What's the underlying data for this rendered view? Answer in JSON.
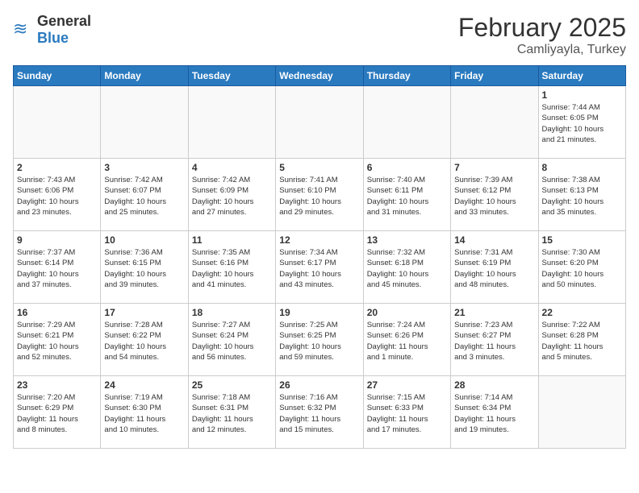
{
  "header": {
    "logo_general": "General",
    "logo_blue": "Blue",
    "month": "February 2025",
    "location": "Camliyayla, Turkey"
  },
  "days_of_week": [
    "Sunday",
    "Monday",
    "Tuesday",
    "Wednesday",
    "Thursday",
    "Friday",
    "Saturday"
  ],
  "weeks": [
    [
      {
        "day": "",
        "info": ""
      },
      {
        "day": "",
        "info": ""
      },
      {
        "day": "",
        "info": ""
      },
      {
        "day": "",
        "info": ""
      },
      {
        "day": "",
        "info": ""
      },
      {
        "day": "",
        "info": ""
      },
      {
        "day": "1",
        "info": "Sunrise: 7:44 AM\nSunset: 6:05 PM\nDaylight: 10 hours\nand 21 minutes."
      }
    ],
    [
      {
        "day": "2",
        "info": "Sunrise: 7:43 AM\nSunset: 6:06 PM\nDaylight: 10 hours\nand 23 minutes."
      },
      {
        "day": "3",
        "info": "Sunrise: 7:42 AM\nSunset: 6:07 PM\nDaylight: 10 hours\nand 25 minutes."
      },
      {
        "day": "4",
        "info": "Sunrise: 7:42 AM\nSunset: 6:09 PM\nDaylight: 10 hours\nand 27 minutes."
      },
      {
        "day": "5",
        "info": "Sunrise: 7:41 AM\nSunset: 6:10 PM\nDaylight: 10 hours\nand 29 minutes."
      },
      {
        "day": "6",
        "info": "Sunrise: 7:40 AM\nSunset: 6:11 PM\nDaylight: 10 hours\nand 31 minutes."
      },
      {
        "day": "7",
        "info": "Sunrise: 7:39 AM\nSunset: 6:12 PM\nDaylight: 10 hours\nand 33 minutes."
      },
      {
        "day": "8",
        "info": "Sunrise: 7:38 AM\nSunset: 6:13 PM\nDaylight: 10 hours\nand 35 minutes."
      }
    ],
    [
      {
        "day": "9",
        "info": "Sunrise: 7:37 AM\nSunset: 6:14 PM\nDaylight: 10 hours\nand 37 minutes."
      },
      {
        "day": "10",
        "info": "Sunrise: 7:36 AM\nSunset: 6:15 PM\nDaylight: 10 hours\nand 39 minutes."
      },
      {
        "day": "11",
        "info": "Sunrise: 7:35 AM\nSunset: 6:16 PM\nDaylight: 10 hours\nand 41 minutes."
      },
      {
        "day": "12",
        "info": "Sunrise: 7:34 AM\nSunset: 6:17 PM\nDaylight: 10 hours\nand 43 minutes."
      },
      {
        "day": "13",
        "info": "Sunrise: 7:32 AM\nSunset: 6:18 PM\nDaylight: 10 hours\nand 45 minutes."
      },
      {
        "day": "14",
        "info": "Sunrise: 7:31 AM\nSunset: 6:19 PM\nDaylight: 10 hours\nand 48 minutes."
      },
      {
        "day": "15",
        "info": "Sunrise: 7:30 AM\nSunset: 6:20 PM\nDaylight: 10 hours\nand 50 minutes."
      }
    ],
    [
      {
        "day": "16",
        "info": "Sunrise: 7:29 AM\nSunset: 6:21 PM\nDaylight: 10 hours\nand 52 minutes."
      },
      {
        "day": "17",
        "info": "Sunrise: 7:28 AM\nSunset: 6:22 PM\nDaylight: 10 hours\nand 54 minutes."
      },
      {
        "day": "18",
        "info": "Sunrise: 7:27 AM\nSunset: 6:24 PM\nDaylight: 10 hours\nand 56 minutes."
      },
      {
        "day": "19",
        "info": "Sunrise: 7:25 AM\nSunset: 6:25 PM\nDaylight: 10 hours\nand 59 minutes."
      },
      {
        "day": "20",
        "info": "Sunrise: 7:24 AM\nSunset: 6:26 PM\nDaylight: 11 hours\nand 1 minute."
      },
      {
        "day": "21",
        "info": "Sunrise: 7:23 AM\nSunset: 6:27 PM\nDaylight: 11 hours\nand 3 minutes."
      },
      {
        "day": "22",
        "info": "Sunrise: 7:22 AM\nSunset: 6:28 PM\nDaylight: 11 hours\nand 5 minutes."
      }
    ],
    [
      {
        "day": "23",
        "info": "Sunrise: 7:20 AM\nSunset: 6:29 PM\nDaylight: 11 hours\nand 8 minutes."
      },
      {
        "day": "24",
        "info": "Sunrise: 7:19 AM\nSunset: 6:30 PM\nDaylight: 11 hours\nand 10 minutes."
      },
      {
        "day": "25",
        "info": "Sunrise: 7:18 AM\nSunset: 6:31 PM\nDaylight: 11 hours\nand 12 minutes."
      },
      {
        "day": "26",
        "info": "Sunrise: 7:16 AM\nSunset: 6:32 PM\nDaylight: 11 hours\nand 15 minutes."
      },
      {
        "day": "27",
        "info": "Sunrise: 7:15 AM\nSunset: 6:33 PM\nDaylight: 11 hours\nand 17 minutes."
      },
      {
        "day": "28",
        "info": "Sunrise: 7:14 AM\nSunset: 6:34 PM\nDaylight: 11 hours\nand 19 minutes."
      },
      {
        "day": "",
        "info": ""
      }
    ]
  ]
}
